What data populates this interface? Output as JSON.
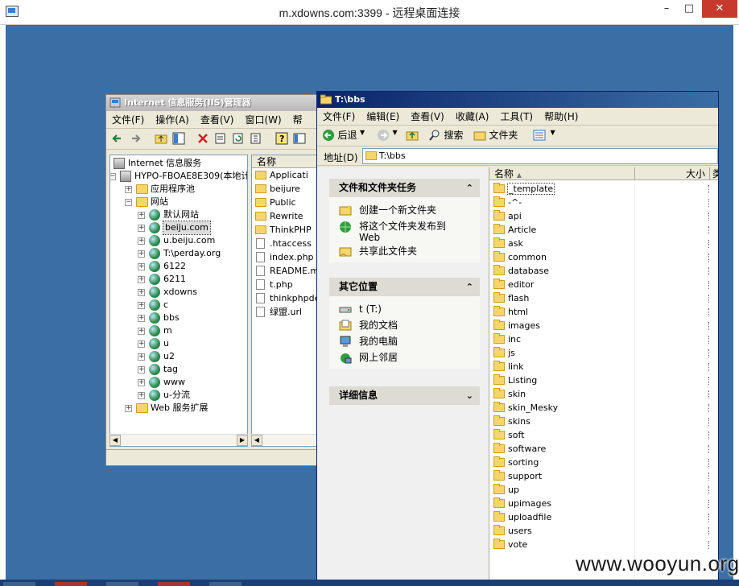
{
  "rdp": {
    "title": "m.xdowns.com:3399 - 远程桌面连接",
    "minimize": "–",
    "maximize": "□",
    "close": "✕"
  },
  "iis": {
    "title": "Internet 信息服务(IIS)管理器",
    "menu": [
      "文件(F)",
      "操作(A)",
      "查看(V)",
      "窗口(W)",
      "帮"
    ],
    "tree": [
      {
        "label": "Internet 信息服务",
        "kind": "root"
      },
      {
        "label": "HYPO-FBOAE8E309(本地计",
        "kind": "server"
      },
      {
        "label": "应用程序池",
        "kind": "folder"
      },
      {
        "label": "网站",
        "kind": "folder"
      },
      {
        "label": "默认网站",
        "kind": "site"
      },
      {
        "label": "beiju.com",
        "kind": "site"
      },
      {
        "label": "u.beiju.com",
        "kind": "site"
      },
      {
        "label": "T:\\perday.org",
        "kind": "site"
      },
      {
        "label": "6122",
        "kind": "site"
      },
      {
        "label": "6211",
        "kind": "site"
      },
      {
        "label": "xdowns",
        "kind": "site"
      },
      {
        "label": "c",
        "kind": "site"
      },
      {
        "label": "bbs",
        "kind": "site"
      },
      {
        "label": "m",
        "kind": "site"
      },
      {
        "label": "u",
        "kind": "site"
      },
      {
        "label": "u2",
        "kind": "site"
      },
      {
        "label": "tag",
        "kind": "site"
      },
      {
        "label": "www",
        "kind": "site"
      },
      {
        "label": "u-分流",
        "kind": "site"
      },
      {
        "label": "Web 服务扩展",
        "kind": "folder"
      }
    ],
    "list_header": "名称",
    "list": [
      {
        "label": "Applicati",
        "kind": "folder"
      },
      {
        "label": "beijure",
        "kind": "folder"
      },
      {
        "label": "Public",
        "kind": "folder"
      },
      {
        "label": "Rewrite",
        "kind": "folder"
      },
      {
        "label": "ThinkPHP",
        "kind": "folder"
      },
      {
        "label": ".htaccess",
        "kind": "file"
      },
      {
        "label": "index.php",
        "kind": "file"
      },
      {
        "label": "README.md",
        "kind": "file"
      },
      {
        "label": "t.php",
        "kind": "file"
      },
      {
        "label": "thinkphpde",
        "kind": "file"
      },
      {
        "label": "绿盟.url",
        "kind": "file"
      }
    ]
  },
  "explorer": {
    "title": "T:\\bbs",
    "menu": [
      "文件(F)",
      "编辑(E)",
      "查看(V)",
      "收藏(A)",
      "工具(T)",
      "帮助(H)"
    ],
    "back_label": "后退",
    "search_label": "搜索",
    "folders_label": "文件夹",
    "address_label": "地址(D)",
    "address_value": "T:\\bbs",
    "sections": {
      "tasks": {
        "title": "文件和文件夹任务",
        "items": [
          "创建一个新文件夹",
          "将这个文件夹发布到 Web",
          "共享此文件夹"
        ]
      },
      "places": {
        "title": "其它位置",
        "items": [
          "t (T:)",
          "我的文档",
          "我的电脑",
          "网上邻居"
        ]
      },
      "details": {
        "title": "详细信息"
      }
    },
    "columns": {
      "name": "名称",
      "size": "大小",
      "type": "类"
    },
    "files": [
      "_template",
      "-^-",
      "api",
      "Article",
      "ask",
      "common",
      "database",
      "editor",
      "flash",
      "html",
      "images",
      "inc",
      "js",
      "link",
      "Listing",
      "skin",
      "skin_Mesky",
      "skins",
      "soft",
      "software",
      "sorting",
      "support",
      "up",
      "upimages",
      "uploadfile",
      "users",
      "vote"
    ]
  },
  "watermark": "www.wooyun.org"
}
